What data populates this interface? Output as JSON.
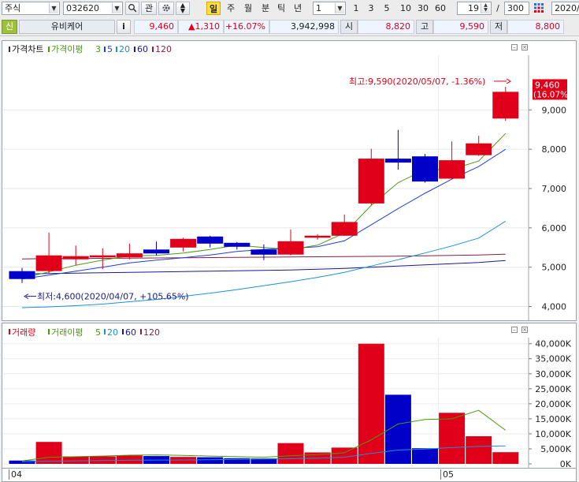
{
  "toolbar": {
    "market": "주식",
    "code": "032620",
    "btn_tube": "관",
    "periods": [
      "일",
      "주",
      "월",
      "분",
      "틱",
      "년"
    ],
    "selected_period": "일",
    "interval_value": "1",
    "quick_intervals": [
      "1",
      "3",
      "5",
      "10",
      "30",
      "60"
    ],
    "count_value": "19",
    "slash": "/",
    "total_value": "300",
    "date_value": "2020/"
  },
  "stock": {
    "type_tag": "신",
    "name": "유비케어",
    "info_btn": "i",
    "price": "9,460",
    "change": "▲1,310",
    "change_pct": "+16.07%",
    "volume": "3,942,998",
    "open_label": "시",
    "open": "8,820",
    "high_label": "고",
    "high": "9,590",
    "low_label": "저",
    "low": "8,800"
  },
  "colors": {
    "up": "#e0001a",
    "down": "#0000c8",
    "ma3": "#4a9a10",
    "ma5": "#1f3fd8",
    "ma20": "#1e8fd8",
    "ma60": "#1a1a8c",
    "ma120": "#8a2040"
  },
  "chart_data": [
    {
      "type": "candlestick",
      "legend": {
        "title": "가격차트",
        "ma_title": "가격이평",
        "periods": [
          "3",
          "5",
          "20",
          "60",
          "120"
        ]
      },
      "yticks": [
        "4,000",
        "5,000",
        "6,000",
        "7,000",
        "8,000",
        "9,000"
      ],
      "ylim": [
        3850,
        9950
      ],
      "xlabels": [
        {
          "label": "04",
          "index": 0
        },
        {
          "label": "05",
          "index": 16
        }
      ],
      "candles": [
        {
          "o": 4900,
          "h": 4980,
          "l": 4600,
          "c": 4700
        },
        {
          "o": 4900,
          "h": 5880,
          "l": 4850,
          "c": 5300
        },
        {
          "o": 5200,
          "h": 5550,
          "l": 5050,
          "c": 5280
        },
        {
          "o": 5250,
          "h": 5480,
          "l": 4950,
          "c": 5300
        },
        {
          "o": 5250,
          "h": 5600,
          "l": 5200,
          "c": 5350
        },
        {
          "o": 5450,
          "h": 5650,
          "l": 5300,
          "c": 5350
        },
        {
          "o": 5500,
          "h": 5750,
          "l": 5400,
          "c": 5720
        },
        {
          "o": 5780,
          "h": 5800,
          "l": 5500,
          "c": 5600
        },
        {
          "o": 5620,
          "h": 5640,
          "l": 5450,
          "c": 5520
        },
        {
          "o": 5450,
          "h": 5580,
          "l": 5180,
          "c": 5320
        },
        {
          "o": 5320,
          "h": 5960,
          "l": 5300,
          "c": 5660
        },
        {
          "o": 5750,
          "h": 5840,
          "l": 5700,
          "c": 5800
        },
        {
          "o": 5800,
          "h": 6340,
          "l": 5800,
          "c": 6150
        },
        {
          "o": 6620,
          "h": 8010,
          "l": 6580,
          "c": 7760
        },
        {
          "o": 7760,
          "h": 8490,
          "l": 7480,
          "c": 7660
        },
        {
          "o": 7820,
          "h": 7880,
          "l": 7150,
          "c": 7180
        },
        {
          "o": 7250,
          "h": 8200,
          "l": 7250,
          "c": 7720
        },
        {
          "o": 7850,
          "h": 8340,
          "l": 7830,
          "c": 8150
        },
        {
          "o": 8780,
          "h": 9590,
          "l": 8720,
          "c": 9460
        }
      ],
      "ma3": [
        4720,
        4880,
        5050,
        5180,
        5290,
        5300,
        5360,
        5450,
        5560,
        5500,
        5450,
        5560,
        5870,
        6570,
        7150,
        7480,
        7490,
        7700,
        8400
      ],
      "ma5": [
        4700,
        4800,
        4900,
        5000,
        5110,
        5180,
        5240,
        5310,
        5400,
        5450,
        5480,
        5520,
        5670,
        6080,
        6490,
        6880,
        7240,
        7560,
        8000
      ],
      "ma20": [
        3970,
        3990,
        4020,
        4060,
        4120,
        4180,
        4260,
        4340,
        4430,
        4530,
        4630,
        4740,
        4870,
        5030,
        5190,
        5360,
        5540,
        5740,
        6170
      ],
      "ma60": [
        4830,
        4840,
        4850,
        4860,
        4870,
        4880,
        4890,
        4900,
        4910,
        4920,
        4930,
        4950,
        4970,
        5000,
        5030,
        5060,
        5090,
        5120,
        5170
      ],
      "ma120": [
        5210,
        5220,
        5220,
        5225,
        5230,
        5235,
        5240,
        5245,
        5250,
        5255,
        5260,
        5265,
        5270,
        5275,
        5280,
        5290,
        5300,
        5310,
        5330
      ],
      "high_annotation": "최고:9,590(2020/05/07, -1.36%)",
      "low_annotation": "최저:4,600(2020/04/07, +105.65%)",
      "current_price_label": "9,460",
      "current_pct_label": "(16.07%)"
    },
    {
      "type": "bar",
      "legend": {
        "title": "거래량",
        "ma_title": "거래이평",
        "periods": [
          "5",
          "20",
          "60",
          "120"
        ]
      },
      "yticks": [
        "0K",
        "5,000K",
        "10,000K",
        "15,000K",
        "20,000K",
        "25,000K",
        "30,000K",
        "35,000K",
        "40,000K"
      ],
      "ylim": [
        0,
        41500
      ],
      "values": [
        1100,
        7300,
        2500,
        2500,
        2800,
        2600,
        2300,
        2200,
        1900,
        1800,
        6900,
        3800,
        5400,
        40000,
        23000,
        5200,
        17000,
        9200,
        3900
      ],
      "vma5": [
        1000,
        2200,
        2400,
        2600,
        2900,
        3000,
        2800,
        2600,
        2400,
        2200,
        2700,
        3100,
        3700,
        8000,
        13300,
        14800,
        15000,
        17800,
        11200
      ],
      "vma20": [
        700,
        900,
        1000,
        1100,
        1200,
        1300,
        1300,
        1400,
        1500,
        1600,
        1700,
        1900,
        2200,
        3500,
        4600,
        4900,
        5400,
        5800,
        6000
      ]
    }
  ]
}
